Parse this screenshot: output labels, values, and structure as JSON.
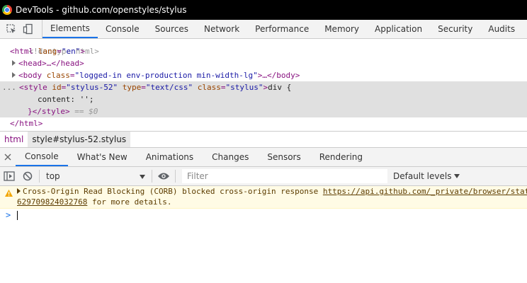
{
  "window": {
    "title": "DevTools - github.com/openstyles/stylus"
  },
  "main_tabs": [
    "Elements",
    "Console",
    "Sources",
    "Network",
    "Performance",
    "Memory",
    "Application",
    "Security",
    "Audits"
  ],
  "elements": {
    "doctype": "<!doctype html>",
    "html_open": {
      "tag": "<html",
      "attr": "lang",
      "val": "\"en\"",
      "close": ">"
    },
    "head": "<head>…</head>",
    "body": {
      "tag": "<body",
      "attr": "class",
      "val": "\"logged-in env-production min-width-lg\"",
      "close": ">…</body>"
    },
    "style": {
      "tag": "<style",
      "attr1": "id",
      "val1": "\"stylus-52\"",
      "attr2": "type",
      "val2": "\"text/css\"",
      "attr3": "class",
      "val3": "\"stylus\"",
      "close": ">",
      "text": "div {"
    },
    "content_line": "content: '';",
    "style_close": "}</style>",
    "style_close_suffix": "== $0",
    "html_close": "</html>",
    "dots": "..."
  },
  "breadcrumbs": [
    "html",
    "style#stylus-52.stylus"
  ],
  "drawer_tabs": [
    "Console",
    "What's New",
    "Animations",
    "Changes",
    "Sensors",
    "Rendering"
  ],
  "console_toolbar": {
    "context": "top",
    "filter_placeholder": "Filter",
    "levels": "Default levels"
  },
  "console_messages": [
    {
      "level": "warning",
      "line1_prefix": "Cross-Origin Read Blocking (CORB) blocked cross-origin response ",
      "link": "https://api.github.com/_private/browser/stat",
      "line2_link": "629709824032768",
      "line2_suffix": " for more details."
    }
  ],
  "prompt": ">"
}
